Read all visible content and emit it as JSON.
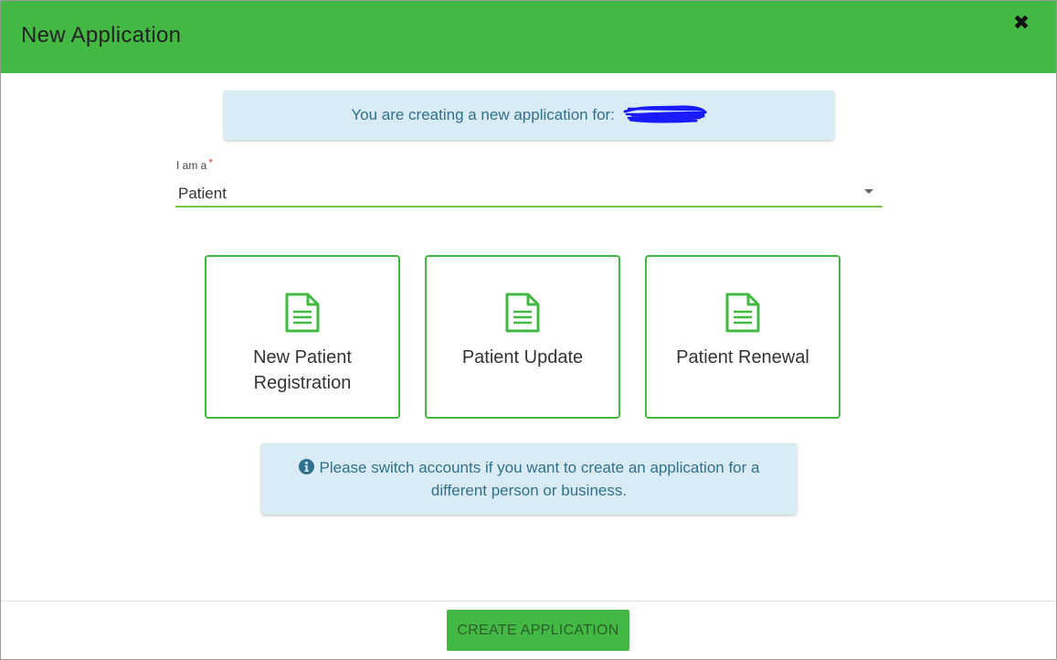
{
  "colors": {
    "brand": "#43b943",
    "info_bg": "#d9ecf5",
    "info_text": "#31708f",
    "required": "#e53935"
  },
  "header": {
    "title": "New Application",
    "close_icon": "close-icon"
  },
  "banner": {
    "text": "You are creating a new application for:"
  },
  "role_field": {
    "label": "I am a",
    "required_mark": "*",
    "value": "Patient"
  },
  "cards": [
    {
      "icon": "document-icon",
      "label": "New Patient Registration"
    },
    {
      "icon": "document-icon",
      "label": "Patient Update"
    },
    {
      "icon": "document-icon",
      "label": "Patient Renewal"
    }
  ],
  "notice": {
    "icon": "info-circle-icon",
    "text": "Please switch accounts if you want to create an application for a different person or business."
  },
  "footer": {
    "create_label": "CREATE APPLICATION"
  }
}
